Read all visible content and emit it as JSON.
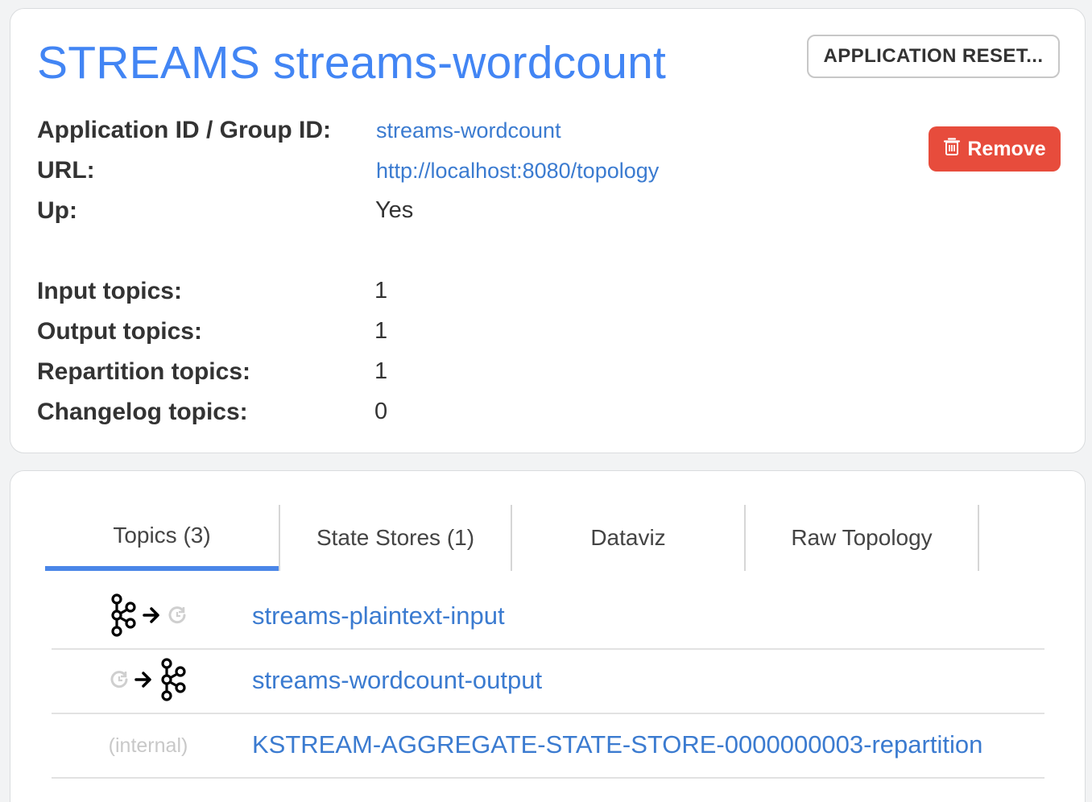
{
  "header": {
    "title": "STREAMS streams-wordcount",
    "reset_label": "APPLICATION RESET...",
    "remove_label": "Remove"
  },
  "info": [
    {
      "label": "Application ID / Group ID:",
      "value": "streams-wordcount",
      "is_link": true
    },
    {
      "label": "URL:",
      "value": "http://localhost:8080/topology",
      "is_link": true
    },
    {
      "label": "Up:",
      "value": "Yes",
      "is_link": false
    }
  ],
  "counts": [
    {
      "label": "Input topics:",
      "value": "1"
    },
    {
      "label": "Output topics:",
      "value": "1"
    },
    {
      "label": "Repartition topics:",
      "value": "1"
    },
    {
      "label": "Changelog topics:",
      "value": "0"
    }
  ],
  "tabs": [
    {
      "label": "Topics (3)",
      "active": true
    },
    {
      "label": "State Stores (1)",
      "active": false
    },
    {
      "label": "Dataviz",
      "active": false
    },
    {
      "label": "Raw Topology",
      "active": false
    }
  ],
  "topics": [
    {
      "name": "streams-plaintext-input",
      "direction": "input",
      "icons": [
        "kafka-icon",
        "arrow-right-icon",
        "streams-icon"
      ]
    },
    {
      "name": "streams-wordcount-output",
      "direction": "output",
      "icons": [
        "streams-icon",
        "arrow-right-icon",
        "kafka-icon"
      ]
    },
    {
      "name": "KSTREAM-AGGREGATE-STATE-STORE-0000000003-repartition",
      "direction": "internal",
      "internal_label": "(internal)"
    }
  ],
  "colors": {
    "title_blue": "#4285f4",
    "link_blue": "#3b7bd0",
    "remove_red": "#e74c3c",
    "tab_underline": "#4a86e8"
  }
}
